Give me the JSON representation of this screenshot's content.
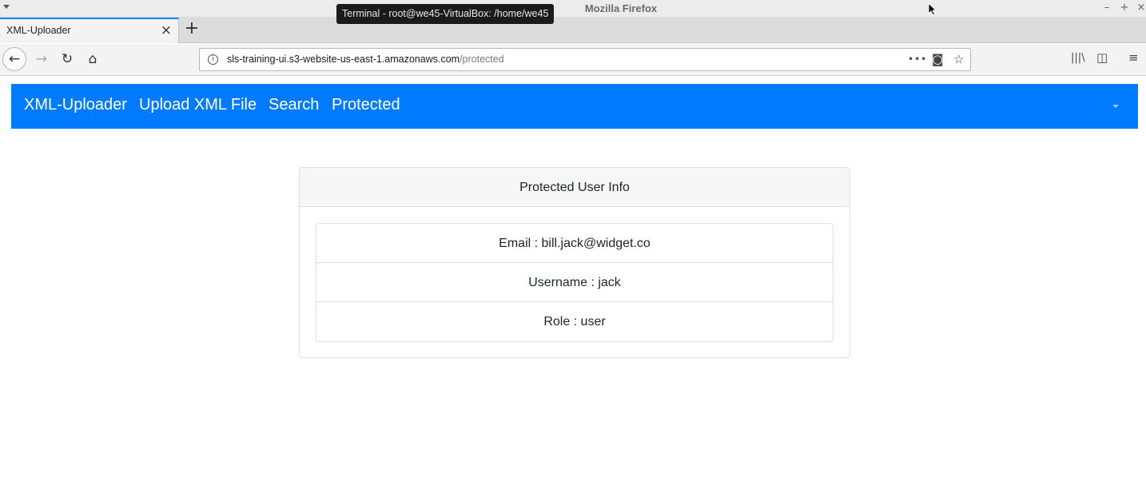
{
  "window": {
    "title": "Mozilla Firefox",
    "tooltip": "Terminal - root@we45-VirtualBox: /home/we45",
    "controls": {
      "minimize": "–",
      "maximize": "+",
      "close": "×"
    }
  },
  "tabs": [
    {
      "label": "XML-Uploader",
      "close": "×"
    }
  ],
  "new_tab": "+",
  "toolbar": {
    "back": "←",
    "forward": "→",
    "reload": "↻",
    "home": "⌂",
    "url_host": "sls-training-ui.s3-website-us-east-1.amazonaws.com",
    "url_path": "/protected",
    "page_actions": "•••",
    "pocket": "◙",
    "bookmark": "☆",
    "library": "|||\\",
    "sidebar": "◫",
    "menu": "≡"
  },
  "app_nav": {
    "brand": "XML-Uploader",
    "links": [
      "Upload XML File",
      "Search",
      "Protected"
    ]
  },
  "card": {
    "header": "Protected User Info",
    "items": [
      "Email : bill.jack@widget.co",
      "Username : jack",
      "Role : user"
    ]
  },
  "colors": {
    "primary": "#007bff",
    "firefox_accent": "#0a84ff"
  }
}
